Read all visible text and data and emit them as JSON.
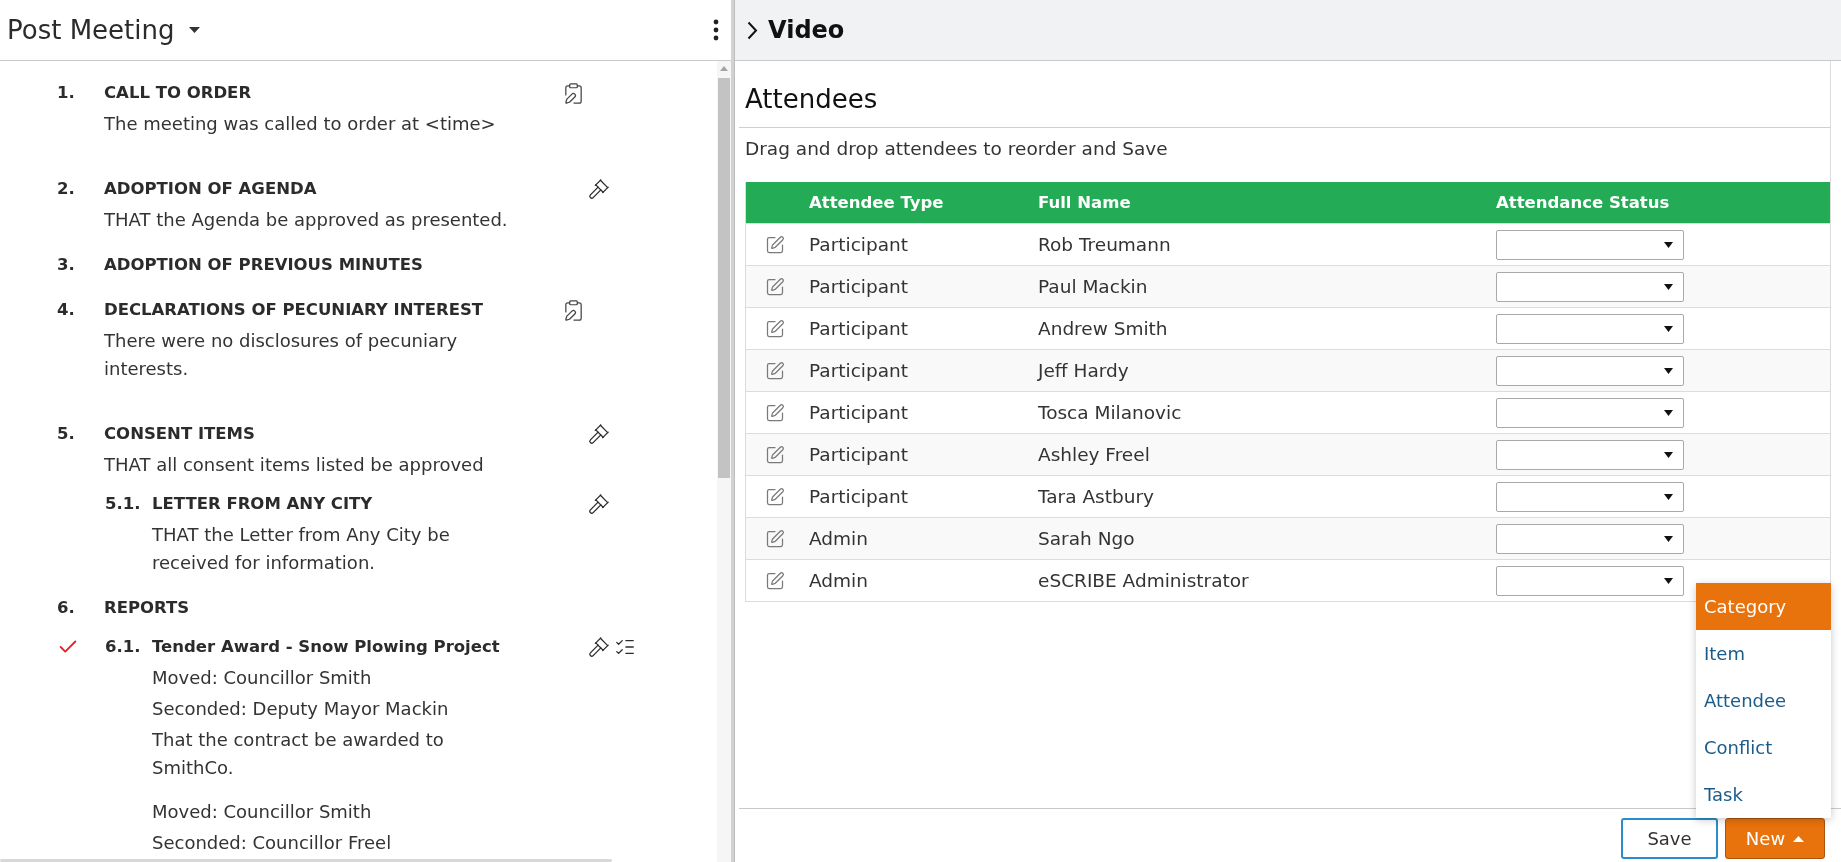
{
  "agenda": {
    "title": "Post Meeting",
    "items": [
      {
        "number": "1.",
        "title": "CALL TO ORDER",
        "kind": "note",
        "checked": false,
        "blocks": [
          [
            "The meeting was called to order at <time>"
          ]
        ]
      },
      {
        "number": "2.",
        "title": "ADOPTION OF AGENDA",
        "kind": "motion",
        "checked": false,
        "blocks": [
          [
            "THAT the Agenda be approved as presented."
          ]
        ]
      },
      {
        "number": "3.",
        "title": "ADOPTION OF PREVIOUS MINUTES",
        "kind": "plain",
        "checked": false
      },
      {
        "number": "4.",
        "title": "DECLARATIONS OF PECUNIARY INTEREST",
        "kind": "note",
        "checked": false,
        "blocks": [
          [
            "There were no disclosures of pecuniary interests."
          ]
        ]
      },
      {
        "number": "5.",
        "title": "CONSENT ITEMS",
        "kind": "motion",
        "checked": false,
        "blocks": [
          [
            "THAT all consent items listed be approved"
          ]
        ],
        "children": [
          {
            "number": "5.1.",
            "title": "LETTER FROM ANY CITY",
            "kind": "motion",
            "checked": false,
            "blocks": [
              [
                "THAT the Letter from Any City be received for information."
              ]
            ]
          }
        ]
      },
      {
        "number": "6.",
        "title": "REPORTS",
        "kind": "plain",
        "checked": false,
        "children": [
          {
            "number": "6.1.",
            "title": "Tender Award - Snow Plowing Project",
            "kind": "motion_tasks",
            "checked": true,
            "blocks": [
              [
                "Moved: Councillor Smith",
                "Seconded: Deputy Mayor Mackin",
                "That the contract be awarded to SmithCo."
              ],
              [
                "Moved: Councillor Smith",
                "Seconded: Councillor Freel"
              ]
            ]
          }
        ]
      }
    ]
  },
  "video": {
    "title": "Video",
    "expanded": false
  },
  "attendees": {
    "title": "Attendees",
    "hint": "Drag and drop attendees to reorder and Save",
    "columns": [
      "Attendee Type",
      "Full Name",
      "Attendance Status"
    ],
    "rows": [
      {
        "type": "Participant",
        "name": "Rob Treumann"
      },
      {
        "type": "Participant",
        "name": "Paul Mackin"
      },
      {
        "type": "Participant",
        "name": "Andrew Smith"
      },
      {
        "type": "Participant",
        "name": "Jeff Hardy"
      },
      {
        "type": "Participant",
        "name": "Tosca Milanovic"
      },
      {
        "type": "Participant",
        "name": "Ashley Freel"
      },
      {
        "type": "Participant",
        "name": "Tara Astbury"
      },
      {
        "type": "Admin",
        "name": "Sarah Ngo"
      },
      {
        "type": "Admin",
        "name": "eSCRIBE Administrator"
      }
    ]
  },
  "footer": {
    "buttons": [
      {
        "kind": "plain",
        "label": "Save",
        "focused": true
      },
      {
        "kind": "dropdown",
        "label": "New",
        "expanded": true,
        "menu": [
          {
            "label": "Category",
            "selected": true
          },
          {
            "label": "Item",
            "selected": false
          },
          {
            "label": "Attendee",
            "selected": false
          },
          {
            "label": "Conflict",
            "selected": false
          },
          {
            "label": "Task",
            "selected": false
          }
        ]
      }
    ]
  }
}
